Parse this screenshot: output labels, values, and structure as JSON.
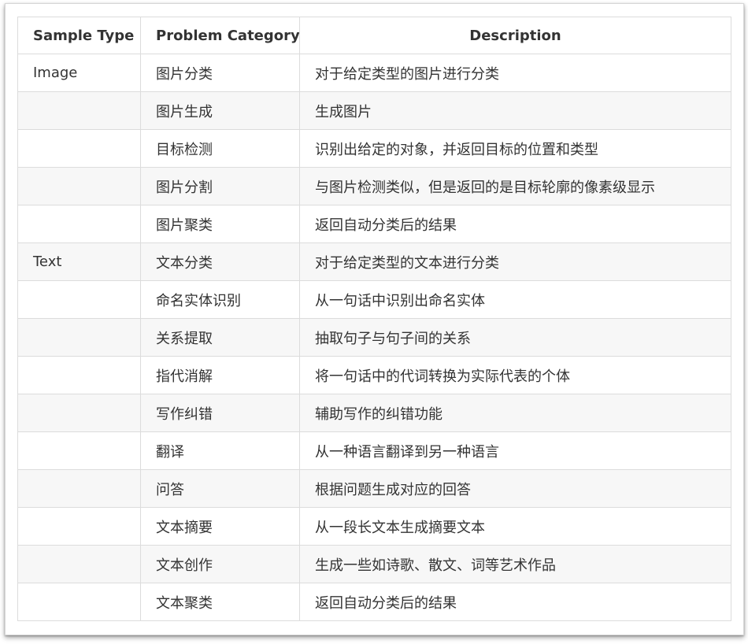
{
  "table": {
    "headers": {
      "sample_type": "Sample Type",
      "problem_category": "Problem Category",
      "description": "Description"
    },
    "rows": [
      {
        "sample_type": "Image",
        "category": "图片分类",
        "description": "对于给定类型的图片进行分类"
      },
      {
        "sample_type": "",
        "category": "图片生成",
        "description": "生成图片"
      },
      {
        "sample_type": "",
        "category": "目标检测",
        "description": "识别出给定的对象，并返回目标的位置和类型"
      },
      {
        "sample_type": "",
        "category": "图片分割",
        "description": "与图片检测类似，但是返回的是目标轮廓的像素级显示"
      },
      {
        "sample_type": "",
        "category": "图片聚类",
        "description": "返回自动分类后的结果"
      },
      {
        "sample_type": "Text",
        "category": "文本分类",
        "description": "对于给定类型的文本进行分类"
      },
      {
        "sample_type": "",
        "category": "命名实体识别",
        "description": "从一句话中识别出命名实体"
      },
      {
        "sample_type": "",
        "category": "关系提取",
        "description": "抽取句子与句子间的关系"
      },
      {
        "sample_type": "",
        "category": "指代消解",
        "description": "将一句话中的代词转换为实际代表的个体"
      },
      {
        "sample_type": "",
        "category": "写作纠错",
        "description": "辅助写作的纠错功能"
      },
      {
        "sample_type": "",
        "category": "翻译",
        "description": "从一种语言翻译到另一种语言"
      },
      {
        "sample_type": "",
        "category": "问答",
        "description": "根据问题生成对应的回答"
      },
      {
        "sample_type": "",
        "category": "文本摘要",
        "description": "从一段长文本生成摘要文本"
      },
      {
        "sample_type": "",
        "category": "文本创作",
        "description": "生成一些如诗歌、散文、词等艺术作品"
      },
      {
        "sample_type": "",
        "category": "文本聚类",
        "description": "返回自动分类后的结果"
      }
    ]
  }
}
